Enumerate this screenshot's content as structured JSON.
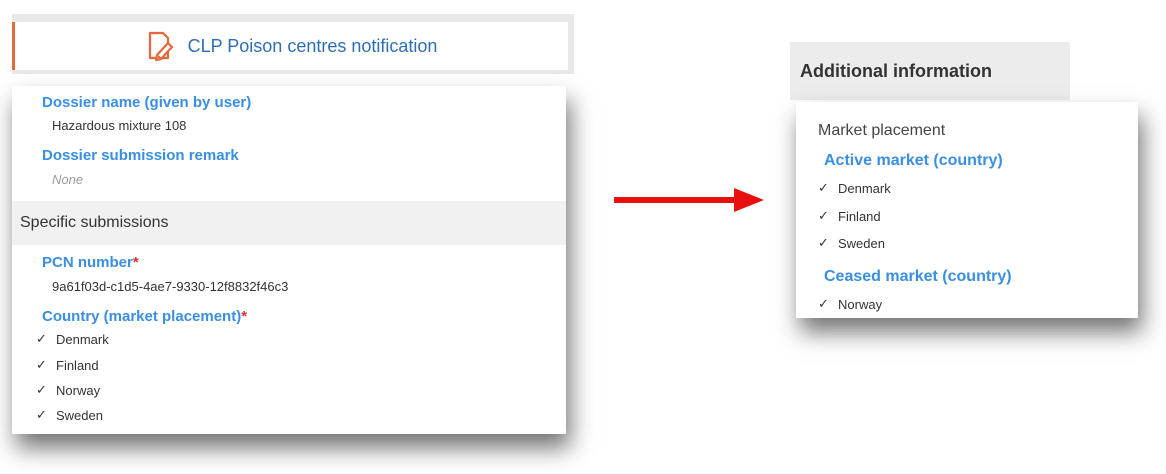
{
  "left_panel": {
    "header_title": "CLP Poison centres notification",
    "dossier_name_label": "Dossier name (given by user)",
    "dossier_name_value": "Hazardous mixture 108",
    "dossier_remark_label": "Dossier submission remark",
    "dossier_remark_value": "None",
    "specific_submissions_title": "Specific submissions",
    "pcn_label": "PCN number",
    "pcn_value": "9a61f03d-c1d5-4ae7-9330-12f8832f46c3",
    "country_label": "Country (market placement)",
    "required_marker": "*",
    "countries": [
      "Denmark",
      "Finland",
      "Norway",
      "Sweden"
    ]
  },
  "right_panel": {
    "header_title": "Additional information",
    "market_placement_title": "Market placement",
    "active_label": "Active market (country)",
    "active_countries": [
      "Denmark",
      "Finland",
      "Sweden"
    ],
    "ceased_label": "Ceased market (country)",
    "ceased_countries": [
      "Norway"
    ]
  },
  "icons": {
    "header_icon": "document-edit-icon",
    "check_icon": "checkmark-icon",
    "arrow": "right-arrow"
  },
  "colors": {
    "accent": "#e8673a",
    "link_blue": "#3a8fe0",
    "required_red": "#d9322e",
    "arrow_red": "#e8100f"
  }
}
